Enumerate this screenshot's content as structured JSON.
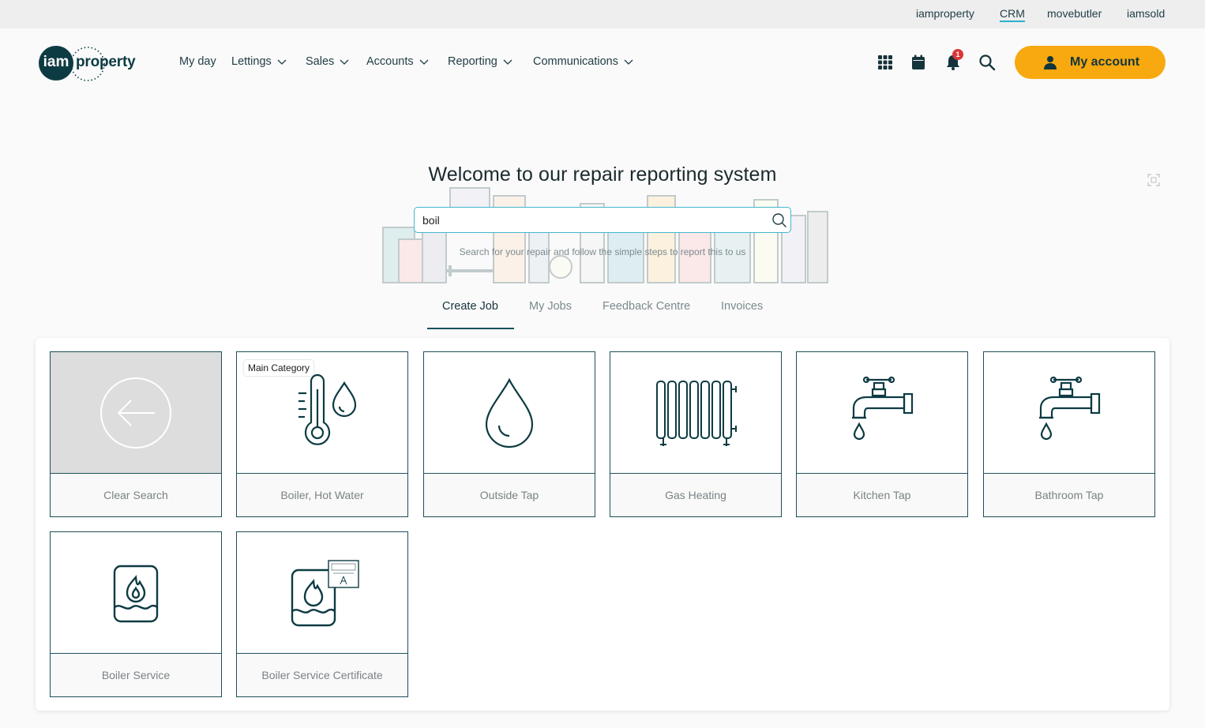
{
  "utility_links": [
    {
      "label": "iamproperty",
      "active": false
    },
    {
      "label": "CRM",
      "active": true
    },
    {
      "label": "movebutler",
      "active": false
    },
    {
      "label": "iamsold",
      "active": false
    }
  ],
  "logo": {
    "circle_text": "iam",
    "text": "property"
  },
  "nav": [
    {
      "label": "My day",
      "dropdown": false
    },
    {
      "label": "Lettings",
      "dropdown": true
    },
    {
      "label": "Sales",
      "dropdown": true
    },
    {
      "label": "Accounts",
      "dropdown": true
    },
    {
      "label": "Reporting",
      "dropdown": true
    },
    {
      "label": "Communications",
      "dropdown": true
    }
  ],
  "header_icons": [
    "apps-grid-icon",
    "calendar-icon",
    "bell-icon",
    "search-icon"
  ],
  "notification_count": "1",
  "account_button": {
    "label": "My account",
    "icon": "user-icon"
  },
  "hero": {
    "title": "Welcome to our repair reporting system",
    "search_value": "boil",
    "hint": "Search for your repair and follow the simple steps to report this to us"
  },
  "tabs": [
    {
      "label": "Create Job",
      "active": true
    },
    {
      "label": "My Jobs",
      "active": false
    },
    {
      "label": "Feedback Centre",
      "active": false
    },
    {
      "label": "Invoices",
      "active": false
    }
  ],
  "cards": [
    {
      "label": "Clear Search",
      "icon": "back-arrow-icon",
      "tag": ""
    },
    {
      "label": "Boiler, Hot Water",
      "icon": "thermometer-drop-icon",
      "tag": "Main Category"
    },
    {
      "label": "Outside Tap",
      "icon": "water-drop-icon",
      "tag": ""
    },
    {
      "label": "Gas Heating",
      "icon": "radiator-icon",
      "tag": ""
    },
    {
      "label": "Kitchen Tap",
      "icon": "tap-icon",
      "tag": ""
    },
    {
      "label": "Bathroom Tap",
      "icon": "tap-icon",
      "tag": ""
    },
    {
      "label": "Boiler Service",
      "icon": "boiler-icon",
      "tag": ""
    },
    {
      "label": "Boiler Service Certificate",
      "icon": "boiler-certificate-icon",
      "tag": ""
    }
  ],
  "colors": {
    "accent": "#f8a90f",
    "brand": "#0d3b43",
    "focus": "#43b8d0",
    "badge": "#d9383a"
  }
}
